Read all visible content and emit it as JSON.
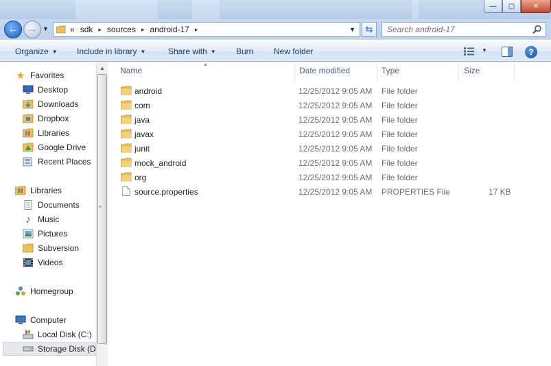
{
  "window": {
    "minimize_glyph": "—",
    "maximize_glyph": "▢",
    "close_glyph": "✕"
  },
  "address": {
    "overflow": "«",
    "crumbs": [
      "sdk",
      "sources",
      "android-17"
    ],
    "separator": "▸"
  },
  "search": {
    "placeholder": "Search android-17"
  },
  "toolbar": {
    "organize": "Organize",
    "include_in_library": "Include in library",
    "share_with": "Share with",
    "burn": "Burn",
    "new_folder": "New folder",
    "help": "?"
  },
  "sidebar": {
    "favorites": {
      "label": "Favorites",
      "items": [
        "Desktop",
        "Downloads",
        "Dropbox",
        "Libraries",
        "Google Drive",
        "Recent Places"
      ]
    },
    "libraries": {
      "label": "Libraries",
      "items": [
        "Documents",
        "Music",
        "Pictures",
        "Subversion",
        "Videos"
      ]
    },
    "homegroup": {
      "label": "Homegroup"
    },
    "computer": {
      "label": "Computer",
      "items": [
        "Local Disk (C:)",
        "Storage Disk (D:)"
      ]
    }
  },
  "columns": {
    "name": "Name",
    "date": "Date modified",
    "type": "Type",
    "size": "Size"
  },
  "files": [
    {
      "name": "android",
      "date": "12/25/2012 9:05 AM",
      "type": "File folder",
      "size": "",
      "icon": "folder-icon"
    },
    {
      "name": "com",
      "date": "12/25/2012 9:05 AM",
      "type": "File folder",
      "size": "",
      "icon": "folder-icon"
    },
    {
      "name": "java",
      "date": "12/25/2012 9:05 AM",
      "type": "File folder",
      "size": "",
      "icon": "folder-icon"
    },
    {
      "name": "javax",
      "date": "12/25/2012 9:05 AM",
      "type": "File folder",
      "size": "",
      "icon": "folder-icon"
    },
    {
      "name": "junit",
      "date": "12/25/2012 9:05 AM",
      "type": "File folder",
      "size": "",
      "icon": "folder-icon"
    },
    {
      "name": "mock_android",
      "date": "12/25/2012 9:05 AM",
      "type": "File folder",
      "size": "",
      "icon": "folder-icon"
    },
    {
      "name": "org",
      "date": "12/25/2012 9:05 AM",
      "type": "File folder",
      "size": "",
      "icon": "folder-icon"
    },
    {
      "name": "source.properties",
      "date": "12/25/2012 9:05 AM",
      "type": "PROPERTIES File",
      "size": "17 KB",
      "icon": "file-icon"
    }
  ],
  "colors": {
    "accent": "#1e395b",
    "folder": "#e8c15a",
    "selection": "#e5e8ec"
  }
}
